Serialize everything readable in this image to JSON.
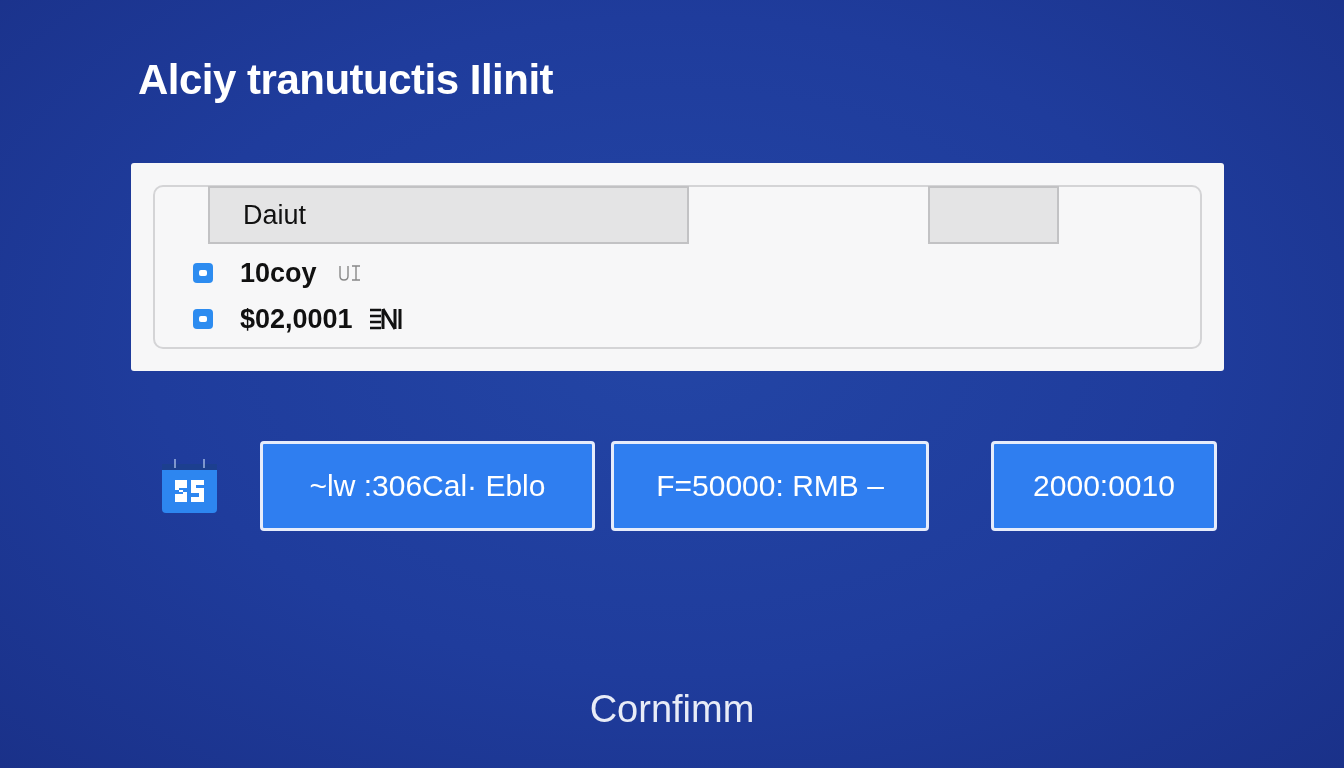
{
  "title": "Alciy tranutuctis Ilinit",
  "panel": {
    "header_tab": "Daiut",
    "rows": [
      {
        "text": "10coy"
      },
      {
        "text": "$02,0001"
      }
    ]
  },
  "buttons": [
    {
      "label": "~lw :306Cal· Eblo"
    },
    {
      "label": "F=50000: RMB –"
    },
    {
      "label": "2000:0010"
    }
  ],
  "confirm": "Cornfimm"
}
